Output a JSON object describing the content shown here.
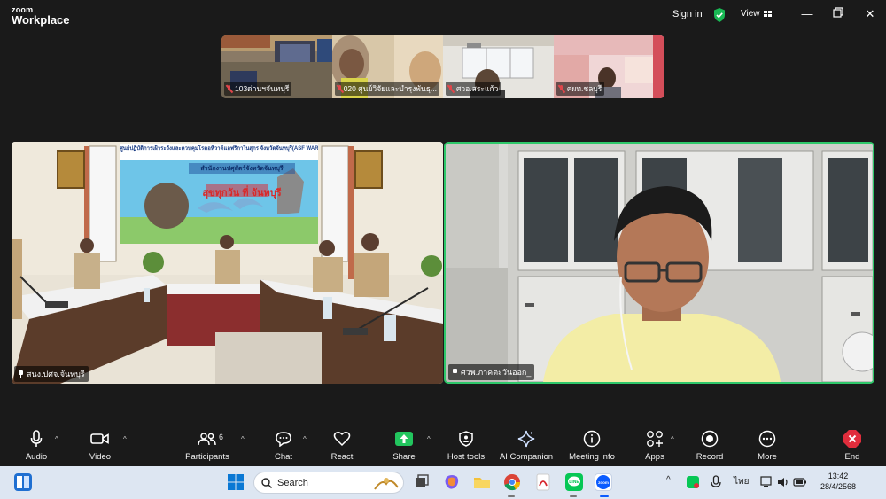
{
  "app": {
    "brand_line1": "zoom",
    "brand_line2": "Workplace",
    "signin_label": "Sign in",
    "view_label": "View"
  },
  "thumbnails": [
    {
      "name": "103ด่านฯจันทบุรี",
      "muted": true
    },
    {
      "name": "020 ศูนย์วิจัยและบำรุงพันธุ...",
      "muted": true
    },
    {
      "name": "ศวอ.สระแก้ว",
      "muted": true
    },
    {
      "name": "ศผท.ชลบุรี",
      "muted": true
    }
  ],
  "main_tiles": {
    "left": {
      "name": "สนง.ปศจ.จันทบุรี",
      "banner_title": "ศูนย์ปฏิบัติการเฝ้าระวังและควบคุมโรคอหิวาต์แอฟริกาในสุกร จังหวัดจันทบุรี(ASF WAR ROOM)",
      "banner_main": "สุขทุกวัน ที่ จันทบุรี",
      "banner_sub": "สำนักงานปศุสัตว์จังหวัดจันทบุรี"
    },
    "right": {
      "name": "ศวพ.ภาคตะวันออก_",
      "active_speaker": true
    }
  },
  "toolbar": {
    "audio": "Audio",
    "video": "Video",
    "participants": "Participants",
    "participants_count": "6",
    "chat": "Chat",
    "react": "React",
    "share": "Share",
    "host_tools": "Host tools",
    "ai_companion": "AI Companion",
    "meeting_info": "Meeting info",
    "apps": "Apps",
    "record": "Record",
    "more": "More",
    "end": "End"
  },
  "taskbar": {
    "search_placeholder": "Search",
    "lang": "ไทย",
    "time": "13:42",
    "date": "28/4/2568"
  },
  "colors": {
    "active_speaker_border": "#2ec86a",
    "share_green": "#22c55e",
    "end_red": "#e02d3c",
    "shield_green": "#19b954"
  }
}
